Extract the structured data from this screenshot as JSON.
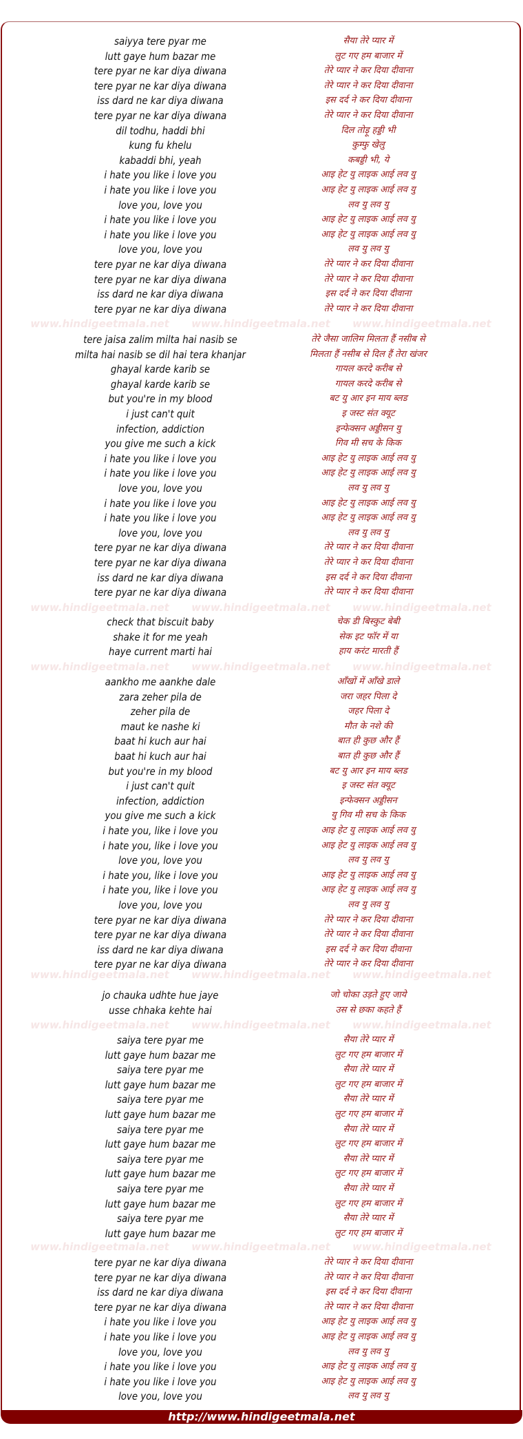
{
  "watermark": "www.hindigeetmala.net",
  "footer": {
    "link_text": "http://www.hindigeetmala.net"
  },
  "colors": {
    "brand": "#800000",
    "hindi_text": "#9a1c1c",
    "english_text": "#111111",
    "watermark": "#f6e6e6"
  },
  "blocks": [
    {
      "lines": [
        {
          "en": "saiyya tere pyar me",
          "hi": "सैया तेरे प्यार में"
        },
        {
          "en": "lutt gaye hum bazar me",
          "hi": "लुट गए हम बाजार में"
        },
        {
          "en": "tere pyar ne kar diya diwana",
          "hi": "तेरे प्यार ने कर दिया दीवाना"
        },
        {
          "en": "tere pyar ne kar diya diwana",
          "hi": "तेरे प्यार ने कर दिया दीवाना"
        },
        {
          "en": "iss dard ne kar diya diwana",
          "hi": "इस दर्द ने कर दिया दीवाना"
        },
        {
          "en": "tere pyar ne kar diya diwana",
          "hi": "तेरे प्यार ने कर दिया दीवाना"
        },
        {
          "en": "dil todhu, haddi bhi",
          "hi": "दिल तोड़ू हड्डी भी"
        },
        {
          "en": "kung fu khelu",
          "hi": "कुम्फु खेलु"
        },
        {
          "en": "kabaddi bhi, yeah",
          "hi": "कबड्डी भी, ये"
        },
        {
          "en": "i hate you like i love you",
          "hi": "आइ हेट यु लाइक आई लव यु"
        },
        {
          "en": "i hate you like i love you",
          "hi": "आइ हेट यु लाइक आई लव यु"
        },
        {
          "en": "love you, love you",
          "hi": "लव यु लव यु"
        },
        {
          "en": "i hate you like i love you",
          "hi": "आइ हेट यु लाइक आई लव यु"
        },
        {
          "en": "i hate you like i love you",
          "hi": "आइ हेट यु लाइक आई लव यु"
        },
        {
          "en": "love you, love you",
          "hi": "लव यु लव यु"
        },
        {
          "en": "tere pyar ne kar diya diwana",
          "hi": "तेरे प्यार ने कर दिया दीवाना"
        },
        {
          "en": "tere pyar ne kar diya diwana",
          "hi": "तेरे प्यार ने कर दिया दीवाना"
        },
        {
          "en": "iss dard ne kar diya diwana",
          "hi": "इस दर्द ने कर दिया दीवाना"
        },
        {
          "en": "tere pyar ne kar diya diwana",
          "hi": "तेरे प्यार ने कर दिया दीवाना"
        }
      ]
    },
    {
      "lines": [
        {
          "en": "tere jaisa zalim milta hai nasib se",
          "hi": "तेरे जैसा जालिम  मिलता हैं नसीब से"
        },
        {
          "en": "milta hai nasib se  dil hai tera khanjar",
          "hi": "मिलता हैं नसीब से दिल हैं तेरा खंजर"
        },
        {
          "en": "ghayal karde karib se",
          "hi": "गायल करदे करीब से"
        },
        {
          "en": "ghayal karde karib se",
          "hi": "गायल करदे करीब से"
        },
        {
          "en": "but you're in my blood",
          "hi": "बट यु आर इन माय ब्लड"
        },
        {
          "en": "i just can't quit",
          "hi": "इ जस्ट संत क्यूट"
        },
        {
          "en": "infection, addiction",
          "hi": "इन्फेक्सन अड्डीसन यु"
        },
        {
          "en": "you give me such a kick",
          "hi": "गिव मी सच के किक"
        },
        {
          "en": "i hate you like i love you",
          "hi": "आइ हेट यु लाइक आई लव यु"
        },
        {
          "en": "i hate you like i love you",
          "hi": "आइ हेट यु लाइक आई लव यु"
        },
        {
          "en": "love you, love you",
          "hi": "लव यु लव यु"
        },
        {
          "en": "i hate you like i love you",
          "hi": "आइ हेट यु लाइक आई लव यु"
        },
        {
          "en": "i hate you like i love you",
          "hi": "आइ हेट यु लाइक आई लव यु"
        },
        {
          "en": "love you, love you",
          "hi": "लव यु लव यु"
        },
        {
          "en": "tere pyar ne kar diya diwana",
          "hi": "तेरे प्यार ने कर दिया दीवाना"
        },
        {
          "en": "tere pyar ne kar diya diwana",
          "hi": "तेरे प्यार ने कर दिया दीवाना"
        },
        {
          "en": "iss dard ne kar diya diwana",
          "hi": "इस दर्द ने कर दिया दीवाना"
        },
        {
          "en": "tere pyar ne kar diya diwana",
          "hi": "तेरे प्यार ने कर दिया दीवाना"
        }
      ]
    },
    {
      "lines": [
        {
          "en": "check that biscuit baby",
          "hi": "चेक डी बिस्कुट बेबी"
        },
        {
          "en": "shake it for me yeah",
          "hi": "सेक इट फॉर में या"
        },
        {
          "en": "haye current marti hai",
          "hi": "हाय करंट मारती हैं"
        }
      ]
    },
    {
      "lines": [
        {
          "en": "aankho me aankhe dale",
          "hi": "आँखों में आँखे डाले"
        },
        {
          "en": "zara zeher pila de",
          "hi": "जरा जहर पिला दे"
        },
        {
          "en": "zeher pila de",
          "hi": "जहर पिला दे"
        },
        {
          "en": "maut ke nashe ki",
          "hi": "मौत के नशे की"
        },
        {
          "en": "baat hi kuch aur hai",
          "hi": "बात ही कुछ और हैं"
        },
        {
          "en": "baat hi kuch aur hai",
          "hi": "बात ही कुछ और हैं"
        },
        {
          "en": "but you're in my blood",
          "hi": "बट यु आर इन माय ब्लड"
        },
        {
          "en": "i just can't quit",
          "hi": "इ जस्ट संत क्यूट"
        },
        {
          "en": "infection, addiction",
          "hi": "इन्फेक्सन अड्डीसन"
        },
        {
          "en": "you give me such a kick",
          "hi": "यु गिव मी सच के किक"
        },
        {
          "en": "i hate you, like i love you",
          "hi": "आइ हेट यु लाइक आई लव यु"
        },
        {
          "en": "i hate you, like i love you",
          "hi": "आइ हेट यु लाइक आई लव यु"
        },
        {
          "en": "love you, love you",
          "hi": "लव यु लव यु"
        },
        {
          "en": "i hate you, like i love you",
          "hi": "आइ हेट यु लाइक आई लव यु"
        },
        {
          "en": "i hate you, like i love you",
          "hi": "आइ हेट यु लाइक आई लव यु"
        },
        {
          "en": "love you, love you",
          "hi": "लव यु लव यु"
        },
        {
          "en": "tere pyar ne kar diya diwana",
          "hi": "तेरे प्यार ने कर दिया दीवाना"
        },
        {
          "en": "tere pyar ne kar diya diwana",
          "hi": "तेरे प्यार ने कर दिया दीवाना"
        },
        {
          "en": "iss dard ne kar diya diwana",
          "hi": "इस दर्द ने कर दिया दीवाना"
        },
        {
          "en": "tere pyar ne kar diya diwana",
          "hi": "तेरे प्यार ने कर दिया दीवाना"
        }
      ]
    },
    {
      "lines": [
        {
          "en": "jo chauka udhte hue jaye",
          "hi": "जो चोका उड़ते हुए जाये"
        },
        {
          "en": "usse chhaka kehte hai",
          "hi": "उस से छका कहते हैं"
        }
      ]
    },
    {
      "lines": [
        {
          "en": "saiya tere pyar me",
          "hi": "सैया तेरे प्यार में"
        },
        {
          "en": "lutt gaye hum bazar me",
          "hi": "लुट गए हम बाजार में"
        },
        {
          "en": "saiya tere pyar me",
          "hi": "सैया तेरे प्यार में"
        },
        {
          "en": "lutt gaye hum bazar me",
          "hi": "लुट गए हम बाजार में"
        },
        {
          "en": "saiya tere pyar me",
          "hi": "सैया तेरे प्यार में"
        },
        {
          "en": "lutt gaye hum bazar me",
          "hi": "लुट गए हम बाजार में"
        },
        {
          "en": "saiya tere pyar me",
          "hi": "सैया तेरे प्यार में"
        },
        {
          "en": "lutt gaye hum bazar me",
          "hi": "लुट गए हम बाजार में"
        },
        {
          "en": "saiya tere pyar me",
          "hi": "सैया तेरे प्यार में"
        },
        {
          "en": "lutt gaye hum bazar me",
          "hi": "लुट गए हम बाजार में"
        },
        {
          "en": "saiya tere pyar me",
          "hi": "सैया तेरे प्यार में"
        },
        {
          "en": "lutt gaye hum bazar me",
          "hi": "लुट गए हम बाजार में"
        },
        {
          "en": "saiya tere pyar me",
          "hi": "सैया तेरे प्यार में"
        },
        {
          "en": "lutt gaye hum bazar me",
          "hi": "लुट गए हम बाजार में"
        }
      ]
    },
    {
      "lines": [
        {
          "en": "tere pyar ne kar diya diwana",
          "hi": "तेरे प्यार ने कर दिया दीवाना"
        },
        {
          "en": "tere pyar ne kar diya diwana",
          "hi": "तेरे प्यार ने कर दिया दीवाना"
        },
        {
          "en": "iss dard ne kar diya diwana",
          "hi": "इस दर्द ने कर दिया दीवाना"
        },
        {
          "en": "tere pyar ne kar diya diwana",
          "hi": "तेरे प्यार ने कर दिया दीवाना"
        },
        {
          "en": "i hate you like i love you",
          "hi": "आइ हेट यु लाइक आई लव यु"
        },
        {
          "en": "i hate you like i love you",
          "hi": "आइ हेट यु लाइक आई लव यु"
        },
        {
          "en": "love you, love you",
          "hi": "लव यु लव यु"
        },
        {
          "en": "i hate you like i love you",
          "hi": "आइ हेट यु लाइक आई लव यु"
        },
        {
          "en": "i hate you like i love you",
          "hi": "आइ हेट यु लाइक आई लव यु"
        },
        {
          "en": "love you, love you",
          "hi": "लव यु लव यु"
        }
      ]
    }
  ]
}
